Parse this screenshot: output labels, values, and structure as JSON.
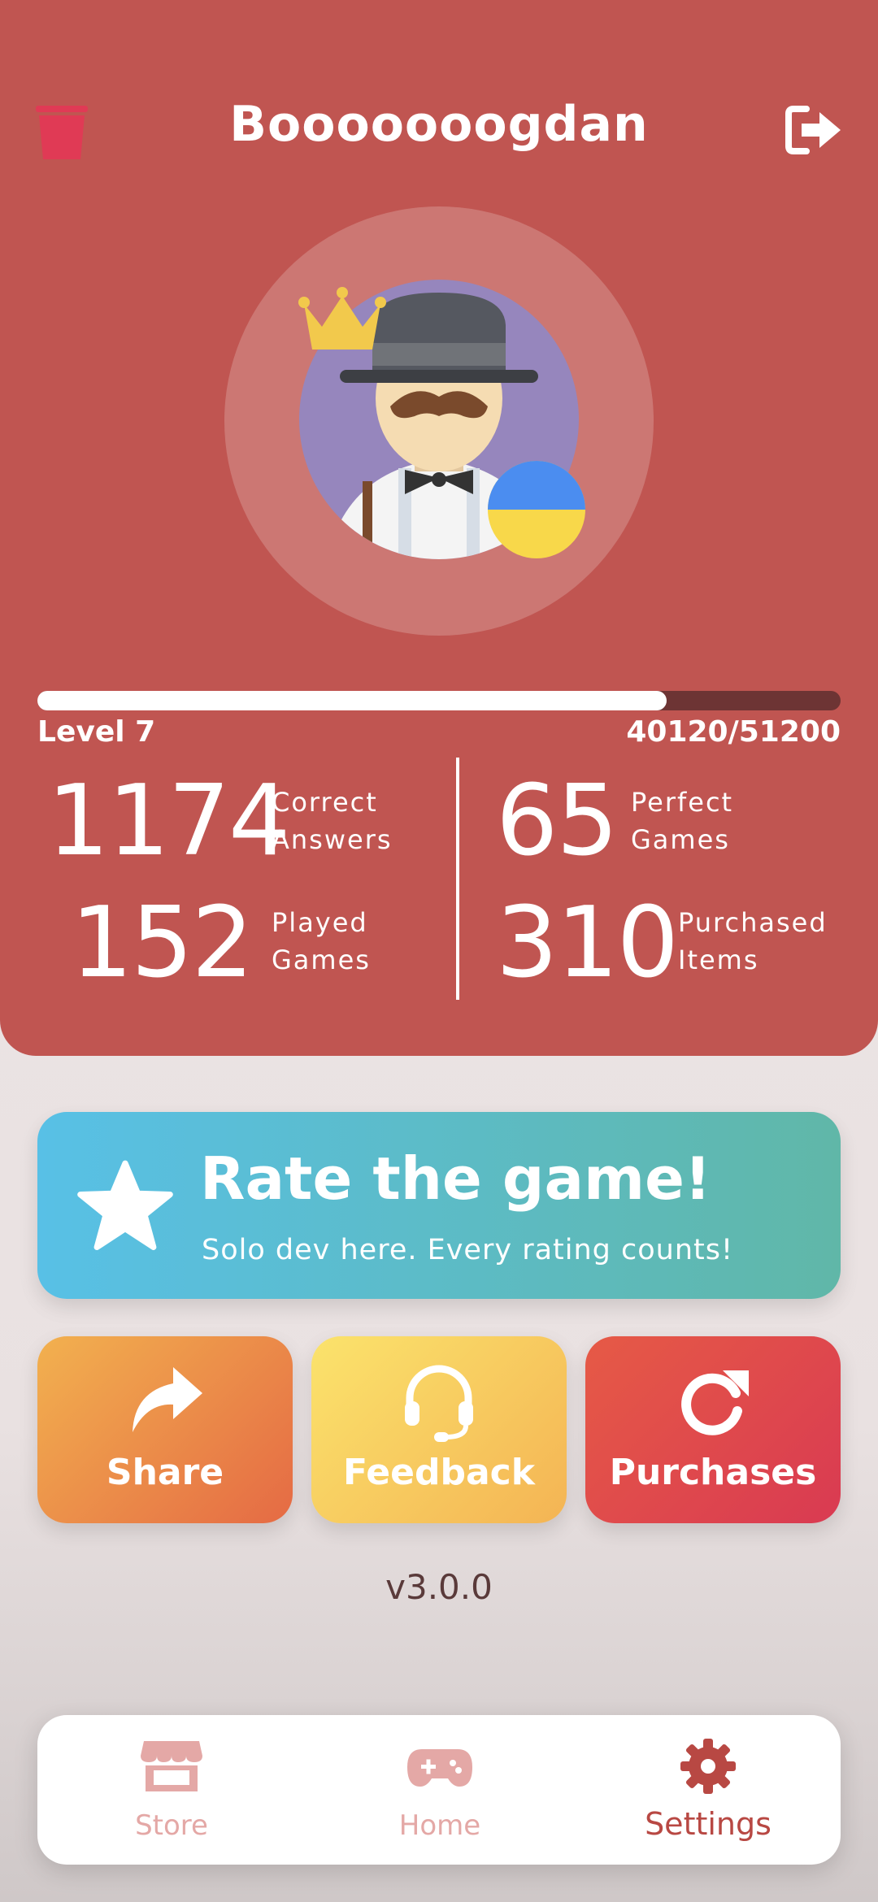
{
  "profile": {
    "username": "Booooooogdan",
    "level_label": "Level 7",
    "xp_text": "40120/51200",
    "xp_progress": 0.7836,
    "flag": "Ukraine"
  },
  "stats": {
    "correct_answers": {
      "value": "1174",
      "label_line1": "Correct",
      "label_line2": "Answers"
    },
    "played_games": {
      "value": "152",
      "label_line1": "Played",
      "label_line2": "Games"
    },
    "perfect_games": {
      "value": "65",
      "label_line1": "Perfect",
      "label_line2": "Games"
    },
    "purchased_items": {
      "value": "310",
      "label_line1": "Purchased",
      "label_line2": "Items"
    }
  },
  "rate_card": {
    "title": "Rate the game!",
    "subtitle": "Solo dev here. Every rating counts!",
    "icon": "star-icon"
  },
  "actions": [
    {
      "label": "Share",
      "icon": "share-icon"
    },
    {
      "label": "Feedback",
      "icon": "headset-icon"
    },
    {
      "label": "Purchases",
      "icon": "restore-icon"
    }
  ],
  "version": "v3.0.0",
  "nav": {
    "items": [
      {
        "label": "Store",
        "icon": "store-icon",
        "active": false
      },
      {
        "label": "Home",
        "icon": "gamepad-icon",
        "active": false
      },
      {
        "label": "Settings",
        "icon": "gear-icon",
        "active": true
      }
    ]
  },
  "colors": {
    "header_bg": "#c05551",
    "page_bg": "#efe8e8",
    "rate_gradient": [
      "#58c0e6",
      "#60b7a8"
    ],
    "share_gradient": [
      "#f2b14f",
      "#e56a44"
    ],
    "feedback_gradient": [
      "#fbe36c",
      "#f4b454"
    ],
    "purchases_gradient": [
      "#e65a46",
      "#d93a52"
    ],
    "nav_active": "#b84843",
    "nav_inactive": "#e4a8a6"
  }
}
